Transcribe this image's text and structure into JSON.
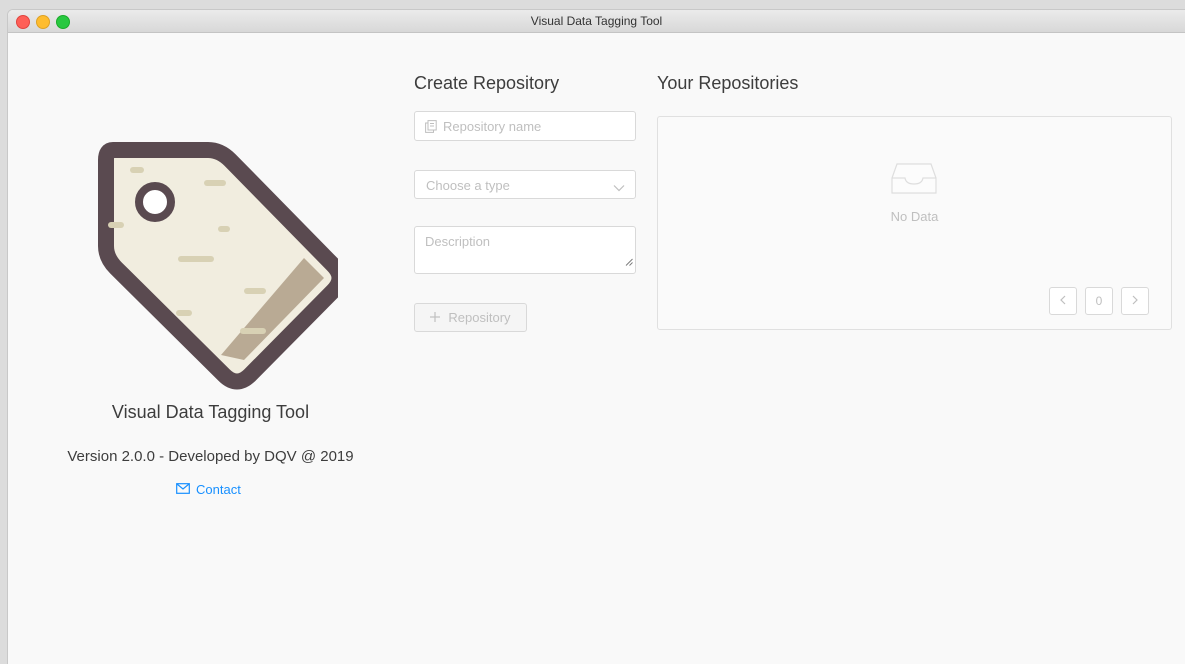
{
  "window": {
    "title": "Visual Data Tagging Tool"
  },
  "about": {
    "app_name": "Visual Data Tagging Tool",
    "version_line": "Version 2.0.0 - Developed by DQV @ 2019",
    "contact_label": "Contact"
  },
  "create": {
    "heading": "Create Repository",
    "name_placeholder": "Repository name",
    "type_placeholder": "Choose a type",
    "description_placeholder": "Description",
    "add_button_label": "Repository"
  },
  "repos": {
    "heading": "Your Repositories",
    "empty_text": "No Data",
    "page_number": "0"
  },
  "colors": {
    "accent": "#1890ff",
    "tag_outline": "#5a4a50",
    "tag_fill": "#f1eddf",
    "tag_band": "#b9aa94"
  }
}
